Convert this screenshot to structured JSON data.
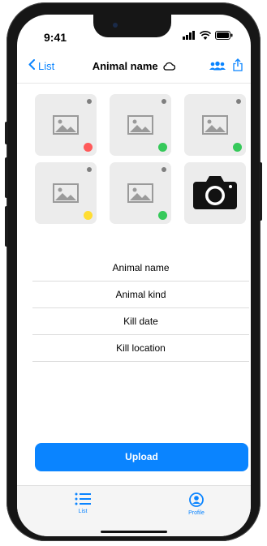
{
  "status": {
    "time": "9:41"
  },
  "nav": {
    "back_label": "List",
    "title": "Animal name",
    "icons": [
      "chevron-left-icon",
      "cloud-icon",
      "people-icon",
      "share-icon"
    ]
  },
  "photos": {
    "tiles": [
      {
        "status_color": "#ff5a5a"
      },
      {
        "status_color": "#36c95a"
      },
      {
        "status_color": "#36c95a"
      },
      {
        "status_color": "#ffdd33"
      },
      {
        "status_color": "#36c95a"
      }
    ],
    "camera_icon": "camera-icon"
  },
  "fields": {
    "animal_name": "Animal name",
    "animal_kind": "Animal kind",
    "kill_date": "Kill date",
    "kill_location": "Kill location"
  },
  "upload_label": "Upload",
  "tabbar": {
    "list_label": "List",
    "profile_label": "Profile"
  },
  "colors": {
    "accent": "#0a84ff"
  }
}
